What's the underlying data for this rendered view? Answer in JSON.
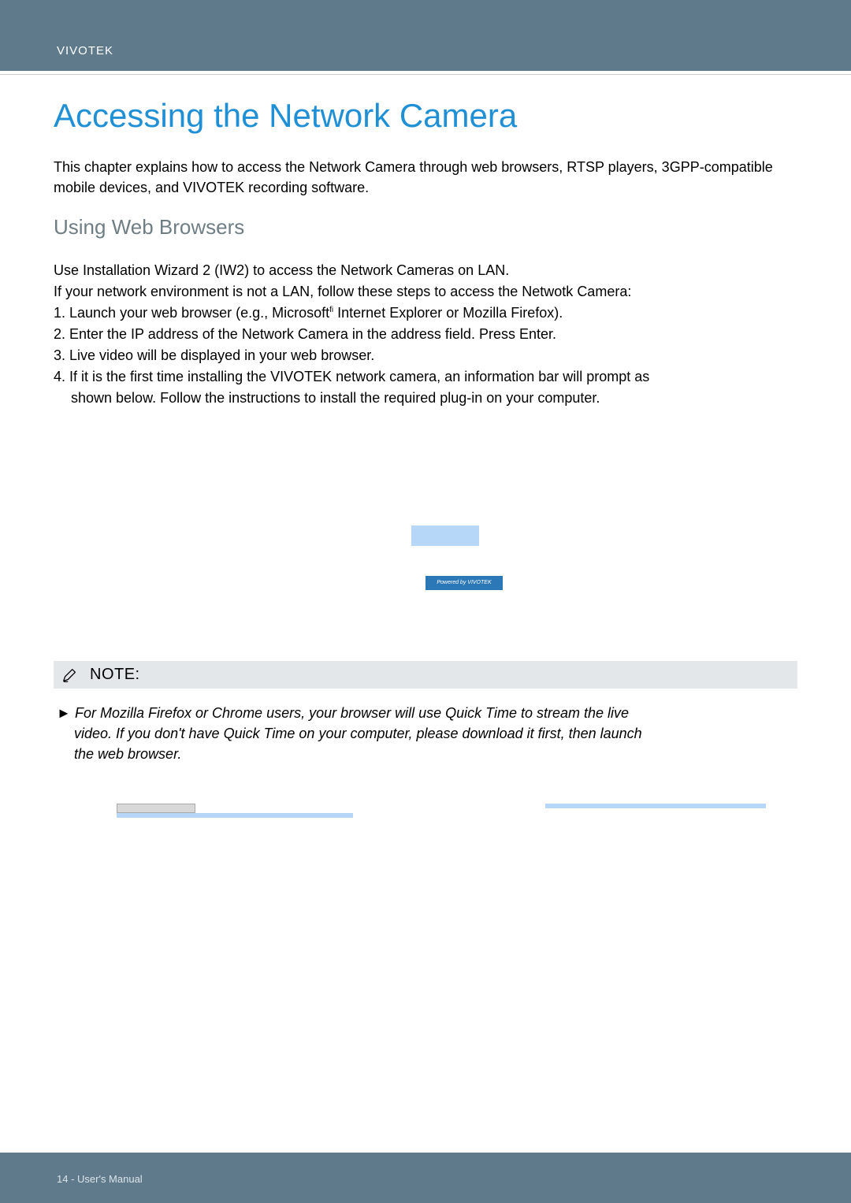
{
  "header": {
    "brand": "VIVOTEK"
  },
  "title": "Accessing the Network Camera",
  "intro": "This chapter explains how to access the Network Camera through web browsers, RTSP players, 3GPP-compatible mobile devices, and VIVOTEK recording software.",
  "subhead": "Using Web Browsers",
  "instructions": {
    "line1": "Use Installation Wizard 2 (IW2) to access the Network Cameras on LAN.",
    "line2": "If your network environment is not a LAN, follow these steps to access the Netwotk Camera:",
    "step1_pre": "1. Launch your web browser (e.g., Microsoft",
    "step1_sup": "fi",
    "step1_post": " Internet Explorer or Mozilla Firefox).",
    "step2": "2. Enter the IP address of the Network Camera in the address field. Press Enter.",
    "step3": "3. Live video will be displayed in your web browser.",
    "step4a": "4. If it is the first time installing the VIVOTEK network camera, an information bar will prompt as",
    "step4b": "shown below. Follow the instructions to install the required plug-in on your computer."
  },
  "powered_tag": "Powered by VIVOTEK",
  "note": {
    "label": "NOTE:",
    "arrow": "►",
    "text_first": "For Mozilla Firefox or Chrome users, your browser will use Quick Time to stream the live",
    "text_rest1": "video. If you don't have Quick Time on your computer, please download it first, then launch",
    "text_rest2": "the web browser."
  },
  "footer": {
    "page": "14 - User's Manual"
  }
}
